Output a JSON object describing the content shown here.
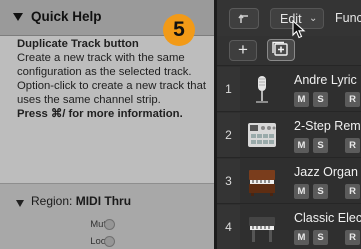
{
  "inspector": {
    "quick_help": {
      "title": "Quick Help",
      "heading": "Duplicate Track button",
      "paragraph_1": "Create a new track with the same configuration as the selected track. Option-click to create a new track that uses the same channel strip.",
      "paragraph_2": "Press ⌘/ for more information."
    },
    "region": {
      "label": "Region:",
      "value": "MIDI Thru",
      "mute_label": "Mute:",
      "loop_label": "Loop:"
    }
  },
  "callout": {
    "number": "5",
    "color": "#f29a17"
  },
  "tracks_toolbar": {
    "back_icon": "arrow-up-left-icon",
    "edit_label": "Edit",
    "functions_label": "Func",
    "add_track_label": "+",
    "duplicate_track_icon": "duplicate-track-icon"
  },
  "tracks": [
    {
      "number": "1",
      "name": "Andre Lyric",
      "icon": "microphone-icon",
      "m": "M",
      "s": "S",
      "r": "R"
    },
    {
      "number": "2",
      "name": "2-Step Rem",
      "icon": "drum-machine-icon",
      "m": "M",
      "s": "S",
      "r": "R"
    },
    {
      "number": "3",
      "name": "Jazz Organ",
      "icon": "organ-icon",
      "m": "M",
      "s": "S",
      "r": "R"
    },
    {
      "number": "4",
      "name": "Classic Elec",
      "icon": "electric-piano-icon",
      "m": "M",
      "s": "S",
      "r": "R"
    }
  ]
}
